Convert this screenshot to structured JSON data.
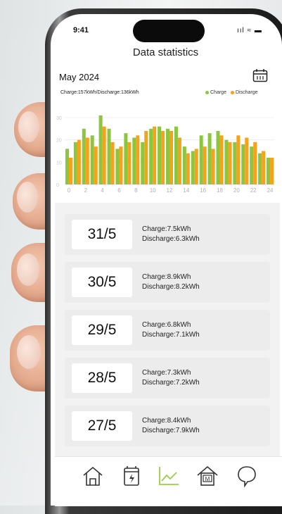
{
  "status": {
    "time": "9:41",
    "icons": "ııl ≈ ▬"
  },
  "header": {
    "title": "Data statistics"
  },
  "period": {
    "month": "May 2024"
  },
  "summary": {
    "text": "Charge:157kWh/Discharge:136kWh"
  },
  "legend": {
    "charge": "Charge",
    "discharge": "Discharge"
  },
  "colors": {
    "charge": "#8cc63f",
    "discharge": "#f7a21b",
    "tab_active": "#9ccc47"
  },
  "chart_data": {
    "type": "bar",
    "x": [
      0,
      1,
      2,
      3,
      4,
      5,
      6,
      7,
      8,
      9,
      10,
      11,
      12,
      13,
      14,
      15,
      16,
      17,
      18,
      19,
      20,
      21,
      22,
      23,
      24
    ],
    "x_tick_labels": [
      "0",
      "2",
      "4",
      "6",
      "8",
      "10",
      "12",
      "14",
      "16",
      "18",
      "20",
      "22",
      "24"
    ],
    "y_tick_labels": [
      "0",
      "10",
      "20",
      "30"
    ],
    "ylim": [
      0,
      36
    ],
    "series": [
      {
        "name": "Charge",
        "values": [
          16,
          19,
          25,
          22,
          31,
          25,
          16,
          23,
          21,
          19,
          25,
          26,
          25,
          26,
          17,
          15,
          22,
          23,
          24,
          20,
          19,
          18,
          17,
          14,
          12
        ]
      },
      {
        "name": "Discharge",
        "values": [
          12,
          20,
          21,
          17,
          26,
          19,
          17,
          19,
          22,
          24,
          26,
          24,
          24,
          21,
          14,
          16,
          17,
          16,
          22,
          19,
          22,
          21,
          19,
          15,
          12
        ]
      }
    ]
  },
  "records": [
    {
      "date": "31/5",
      "charge": "Charge:7.5kWh",
      "discharge": "Discharge:6.3kWh"
    },
    {
      "date": "30/5",
      "charge": "Charge:8.9kWh",
      "discharge": "Discharge:8.2kWh"
    },
    {
      "date": "29/5",
      "charge": "Charge:6.8kWh",
      "discharge": "Discharge:7.1kWh"
    },
    {
      "date": "28/5",
      "charge": "Charge:7.3kWh",
      "discharge": "Discharge:7.2kWh"
    },
    {
      "date": "27/5",
      "charge": "Charge:8.4kWh",
      "discharge": "Discharge:7.9kWh"
    }
  ],
  "tabs": [
    {
      "icon": "home-icon"
    },
    {
      "icon": "battery-device-icon"
    },
    {
      "icon": "statistics-chart-icon"
    },
    {
      "icon": "meter-house-icon"
    },
    {
      "icon": "profile-icon"
    }
  ]
}
